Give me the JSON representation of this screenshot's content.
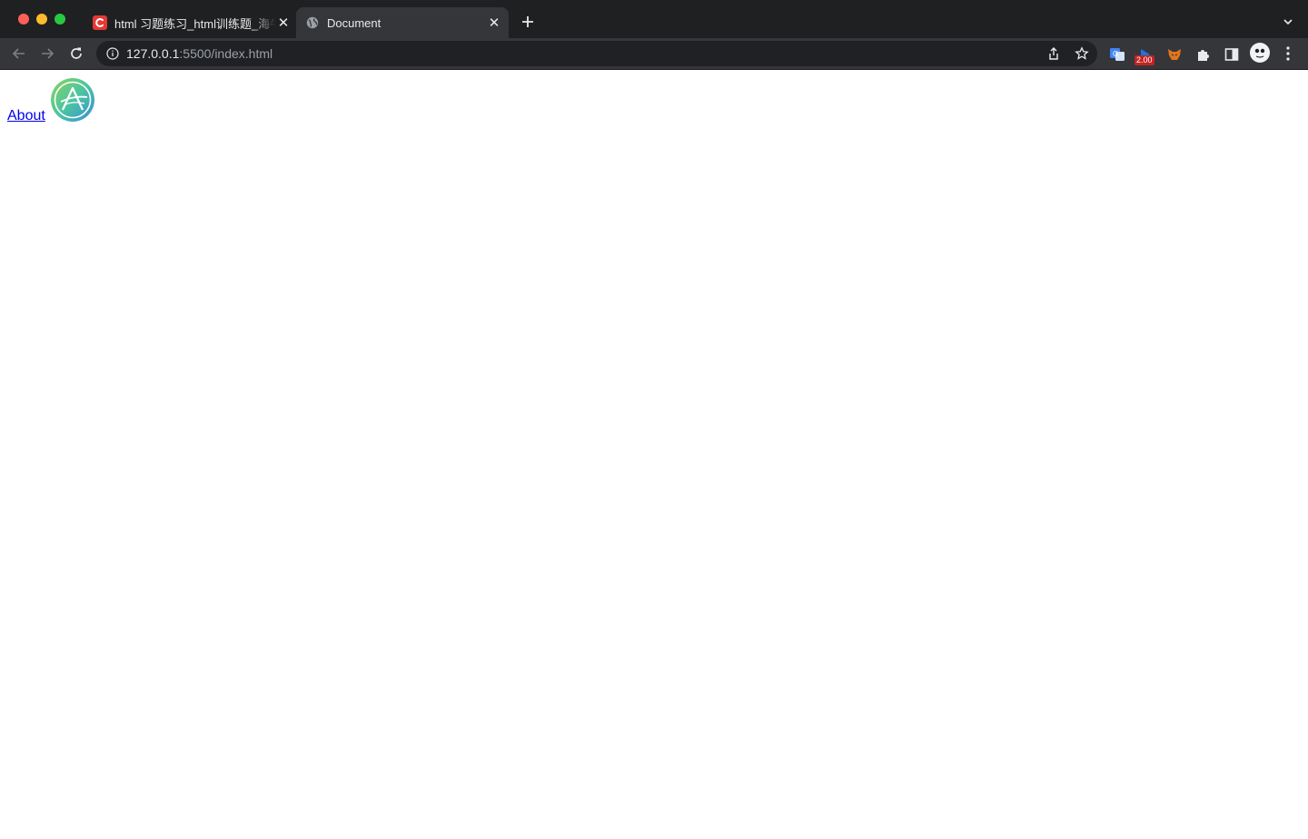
{
  "browser": {
    "tabs": [
      {
        "title": "html 习题练习_html训练题_海牛",
        "favicon": "c-brand-icon",
        "active": false
      },
      {
        "title": "Document",
        "favicon": "globe-icon",
        "active": true
      }
    ],
    "new_tab_icon": "plus-icon",
    "address": {
      "host": "127.0.0.1",
      "rest": ":5500/index.html"
    },
    "extensions": {
      "badge": "2.00"
    },
    "colors": {
      "tabstrip": "#1f2022",
      "toolbar": "#35363a",
      "omnibox": "#202124",
      "link": "#0000ee"
    }
  },
  "page": {
    "link_text": "About",
    "logo_icon": "circle-a-logo"
  }
}
